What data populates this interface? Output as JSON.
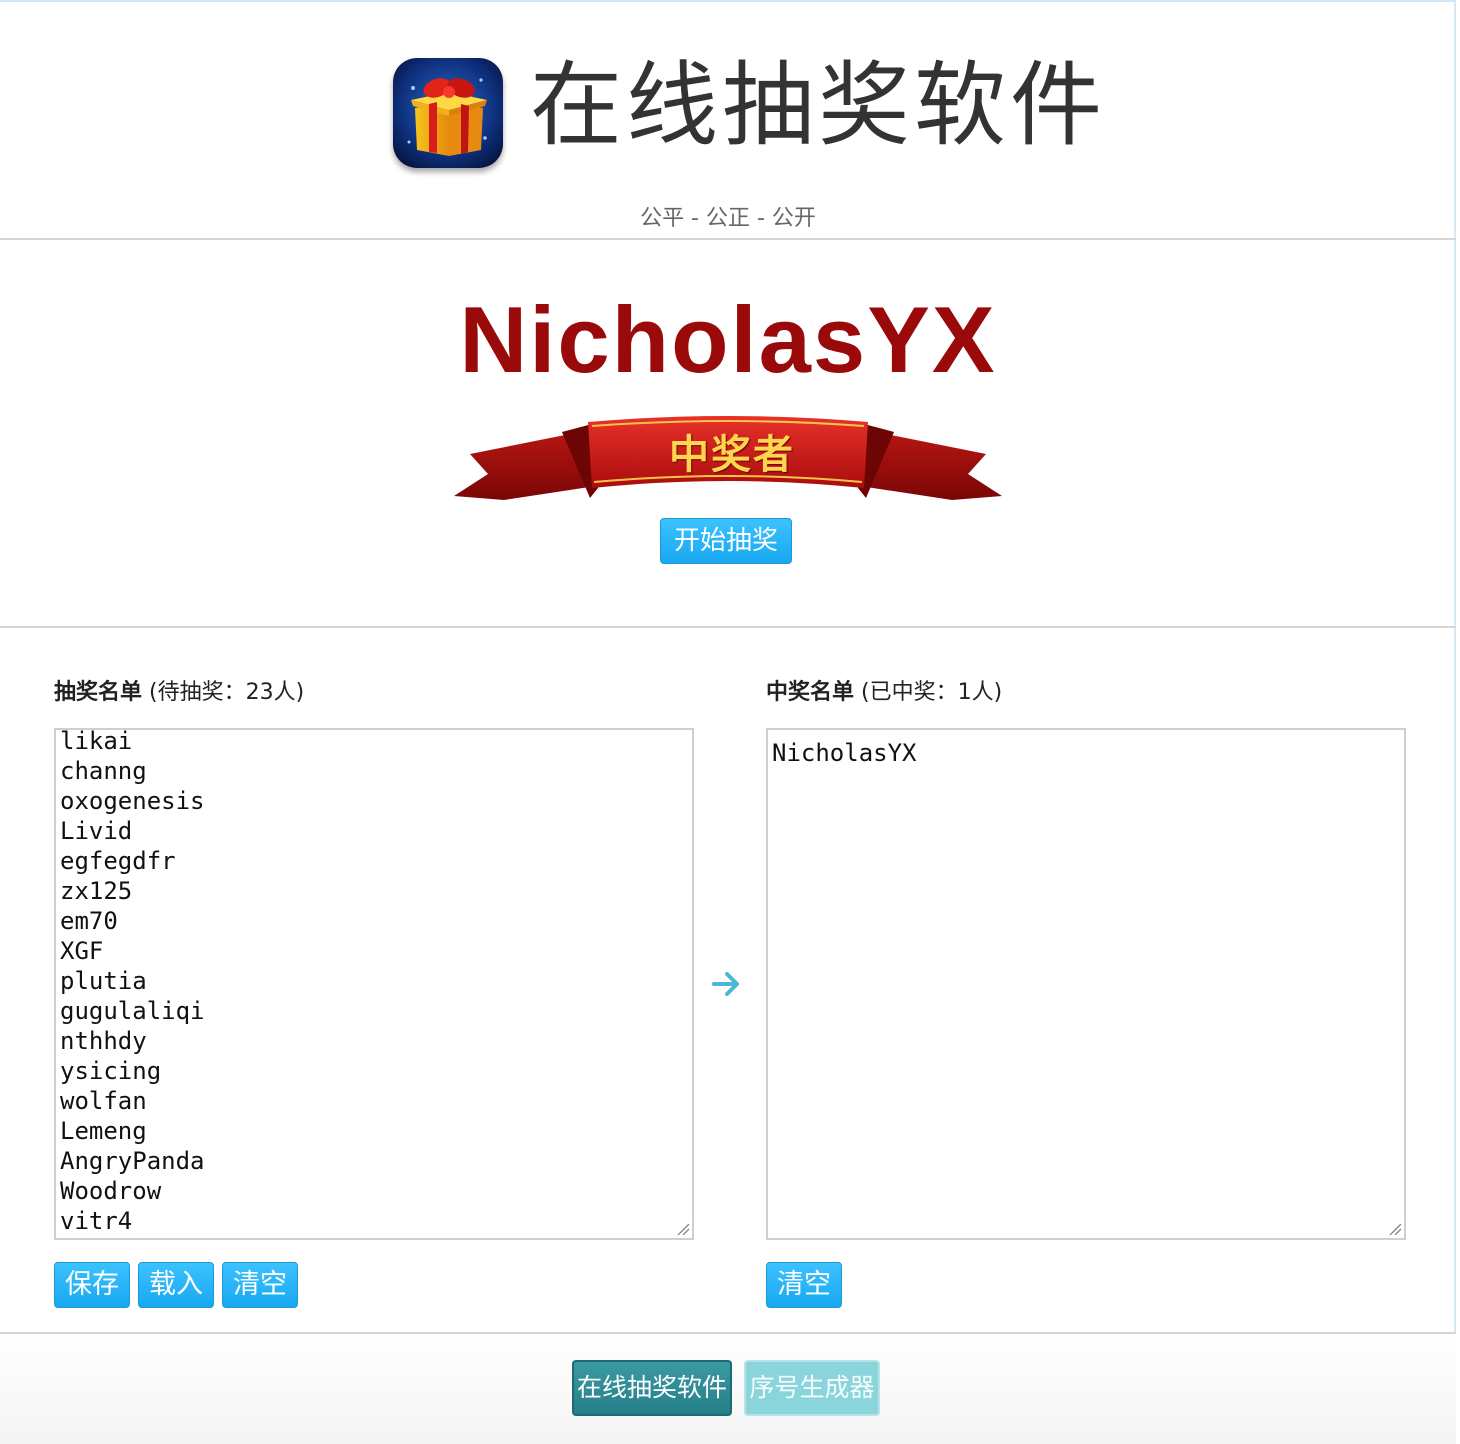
{
  "header": {
    "app_icon": "gift-box-icon",
    "title": "在线抽奖软件",
    "subtitle": "公平 - 公正 - 公开"
  },
  "winner": {
    "name": "NicholasYX",
    "ribbon_label": "中奖者",
    "start_button": "开始抽奖"
  },
  "candidates": {
    "label_bold": "抽奖名单",
    "label_count": "(待抽奖：23人)",
    "visible_names": [
      "likai",
      "channg",
      "oxogenesis",
      "Livid",
      "egfegdfr",
      "zx125",
      "em70",
      "XGF",
      "plutia",
      "gugulaliqi",
      "nthhdy",
      "ysicing",
      "wolfan",
      "Lemeng",
      "AngryPanda",
      "Woodrow",
      "vitr4"
    ],
    "buttons": {
      "save": "保存",
      "load": "载入",
      "clear": "清空"
    }
  },
  "transfer_icon": "arrow-right-icon",
  "winners_list": {
    "label_bold": "中奖名单",
    "label_count": "(已中奖：1人)",
    "names": [
      "NicholasYX"
    ],
    "buttons": {
      "clear": "清空"
    }
  },
  "footer": {
    "tabs": [
      {
        "label": "在线抽奖软件",
        "active": true
      },
      {
        "label": "序号生成器",
        "active": false
      }
    ]
  },
  "colors": {
    "winner_name": "#9b0a0a",
    "button_blue": "#18a8f0",
    "footer_active": "#267f88",
    "footer_inactive": "#8ad4dc"
  }
}
